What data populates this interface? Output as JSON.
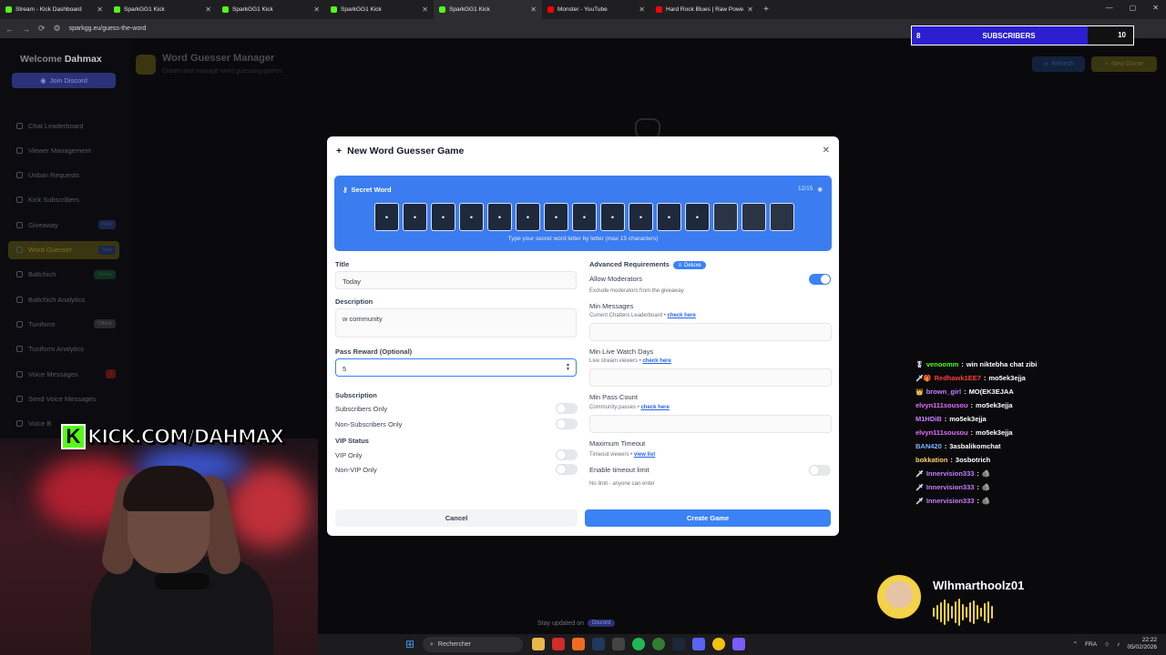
{
  "browser": {
    "tabs": [
      {
        "label": "Stream - Kick Dashboard",
        "color": "#53fc18",
        "active": false
      },
      {
        "label": "SparkGG1 Kick",
        "color": "#53fc18",
        "active": false
      },
      {
        "label": "SparkGG1 Kick",
        "color": "#53fc18",
        "active": false
      },
      {
        "label": "SparkGG1 Kick",
        "color": "#53fc18",
        "active": false
      },
      {
        "label": "SparkGG1 Kick",
        "color": "#53fc18",
        "active": true
      },
      {
        "label": "Monster - YouTube",
        "color": "#ff0000",
        "active": false
      },
      {
        "label": "Hard Rock Blues | Raw Power, G",
        "color": "#ff0000",
        "active": false
      }
    ],
    "url": "sparkgg.eu/guess-the-word"
  },
  "sidebar": {
    "welcome_prefix": "Welcome",
    "username": "Dahmax",
    "discord_button": "Join Discord",
    "items": [
      {
        "label": "Chat Leaderboard",
        "badge": ""
      },
      {
        "label": "Viewer Management",
        "badge": ""
      },
      {
        "label": "Unban Requests",
        "badge": ""
      },
      {
        "label": "Kick Subscribers",
        "badge": ""
      },
      {
        "label": "Giveaway",
        "badge": "New"
      },
      {
        "label": "Word Guesser",
        "badge": "New"
      },
      {
        "label": "Baltchich",
        "badge": "Online"
      },
      {
        "label": "Baltchich Analytics",
        "badge": ""
      },
      {
        "label": "Tuniform",
        "badge": "Offline"
      },
      {
        "label": "Tuniform Analytics",
        "badge": ""
      },
      {
        "label": "Voice Messages",
        "badge": "1"
      },
      {
        "label": "Send Voice Messages",
        "badge": ""
      },
      {
        "label": "Voice B",
        "badge": ""
      }
    ]
  },
  "header": {
    "title": "Word Guesser Manager",
    "subtitle": "Create and manage word guessing games",
    "refresh_label": "Refresh",
    "new_game_label": "New Game"
  },
  "footer": {
    "stay_updated": "Stay updated on",
    "stay_badge": "Discord"
  },
  "modal": {
    "title": "New Word Guesser Game",
    "secret_word_label": "Secret Word",
    "secret_count": "12/15",
    "letters": [
      "•",
      "•",
      "•",
      "•",
      "•",
      "•",
      "•",
      "•",
      "•",
      "•",
      "•",
      "•",
      "",
      "",
      ""
    ],
    "secret_hint": "Type your secret word letter by letter (max 15 characters)",
    "title_label": "Title",
    "title_value": "Today",
    "description_label": "Description",
    "description_value": "w community",
    "pass_reward_label": "Pass Reward (Optional)",
    "pass_reward_value": "5",
    "subscription_label": "Subscription",
    "subscribers_only": "Subscribers Only",
    "non_subscribers_only": "Non-Subscribers Only",
    "vip_status_label": "VIP Status",
    "vip_only": "VIP Only",
    "non_vip_only": "Non-VIP Only",
    "advanced_label": "Advanced Requirements",
    "deluxe_badge": "Deluxe",
    "allow_moderators": "Allow Moderators",
    "allow_moderators_sub": "Exclude moderators from the giveaway",
    "min_messages": "Min Messages",
    "min_messages_sub": "Current Chatters Leaderboard •",
    "min_live_watch": "Min Live Watch Days",
    "min_live_watch_sub": "Live stream viewers •",
    "min_pass_count": "Min Pass Count",
    "min_pass_count_sub": "Community passes •",
    "check_here": "check here",
    "max_timeout": "Maximum Timeout",
    "max_timeout_sub": "Timeout viewers •",
    "view_list": "view list",
    "enable_timeout": "Enable timeout limit",
    "enable_timeout_sub": "No limit - anyone can enter",
    "cancel_label": "Cancel",
    "create_label": "Create Game"
  },
  "overlay": {
    "sub_count": "8",
    "sub_label": "SUBSCRIBERS",
    "sub_goal": "10",
    "kick_letter": "K",
    "kick_text": "KICK.COM/DAHMAX",
    "chat": [
      {
        "badge": "🎖",
        "user": "venoomm",
        "color": "#53fc18",
        "msg": "win niktebha chat zibi"
      },
      {
        "badge": "🗡🎁",
        "user": "Redhawk1EE7",
        "color": "#ff3b3b",
        "msg": "mo5ek3ejja"
      },
      {
        "badge": "👑",
        "user": "brown_girl",
        "color": "#c77dff",
        "msg": "MO(EK3EJAA"
      },
      {
        "badge": "",
        "user": "elvyn111sousou",
        "color": "#e86bff",
        "msg": "mo5ek3ejja"
      },
      {
        "badge": "",
        "user": "M1HDiB",
        "color": "#c77dff",
        "msg": "mo5ek3ejja"
      },
      {
        "badge": "",
        "user": "elvyn111sousou",
        "color": "#e86bff",
        "msg": "mo5ek3ejja"
      },
      {
        "badge": "",
        "user": "BAN420",
        "color": "#7fb3ff",
        "msg": "3asbalikomchat"
      },
      {
        "badge": "",
        "user": "bokkation",
        "color": "#ffd166",
        "msg": "3osbotrich"
      },
      {
        "badge": "🗡",
        "user": "Innervision333",
        "color": "#c77dff",
        "msg": "🪨"
      },
      {
        "badge": "🗡",
        "user": "Innervision333",
        "color": "#c77dff",
        "msg": "🪨"
      },
      {
        "badge": "🗡",
        "user": "Innervision333",
        "color": "#c77dff",
        "msg": "🪨"
      }
    ],
    "alert_name": "Wlhmarthoolz01"
  },
  "taskbar": {
    "search_label": "Rechercher",
    "lang": "FRA",
    "time": "22:22",
    "date": "05/02/2026"
  }
}
